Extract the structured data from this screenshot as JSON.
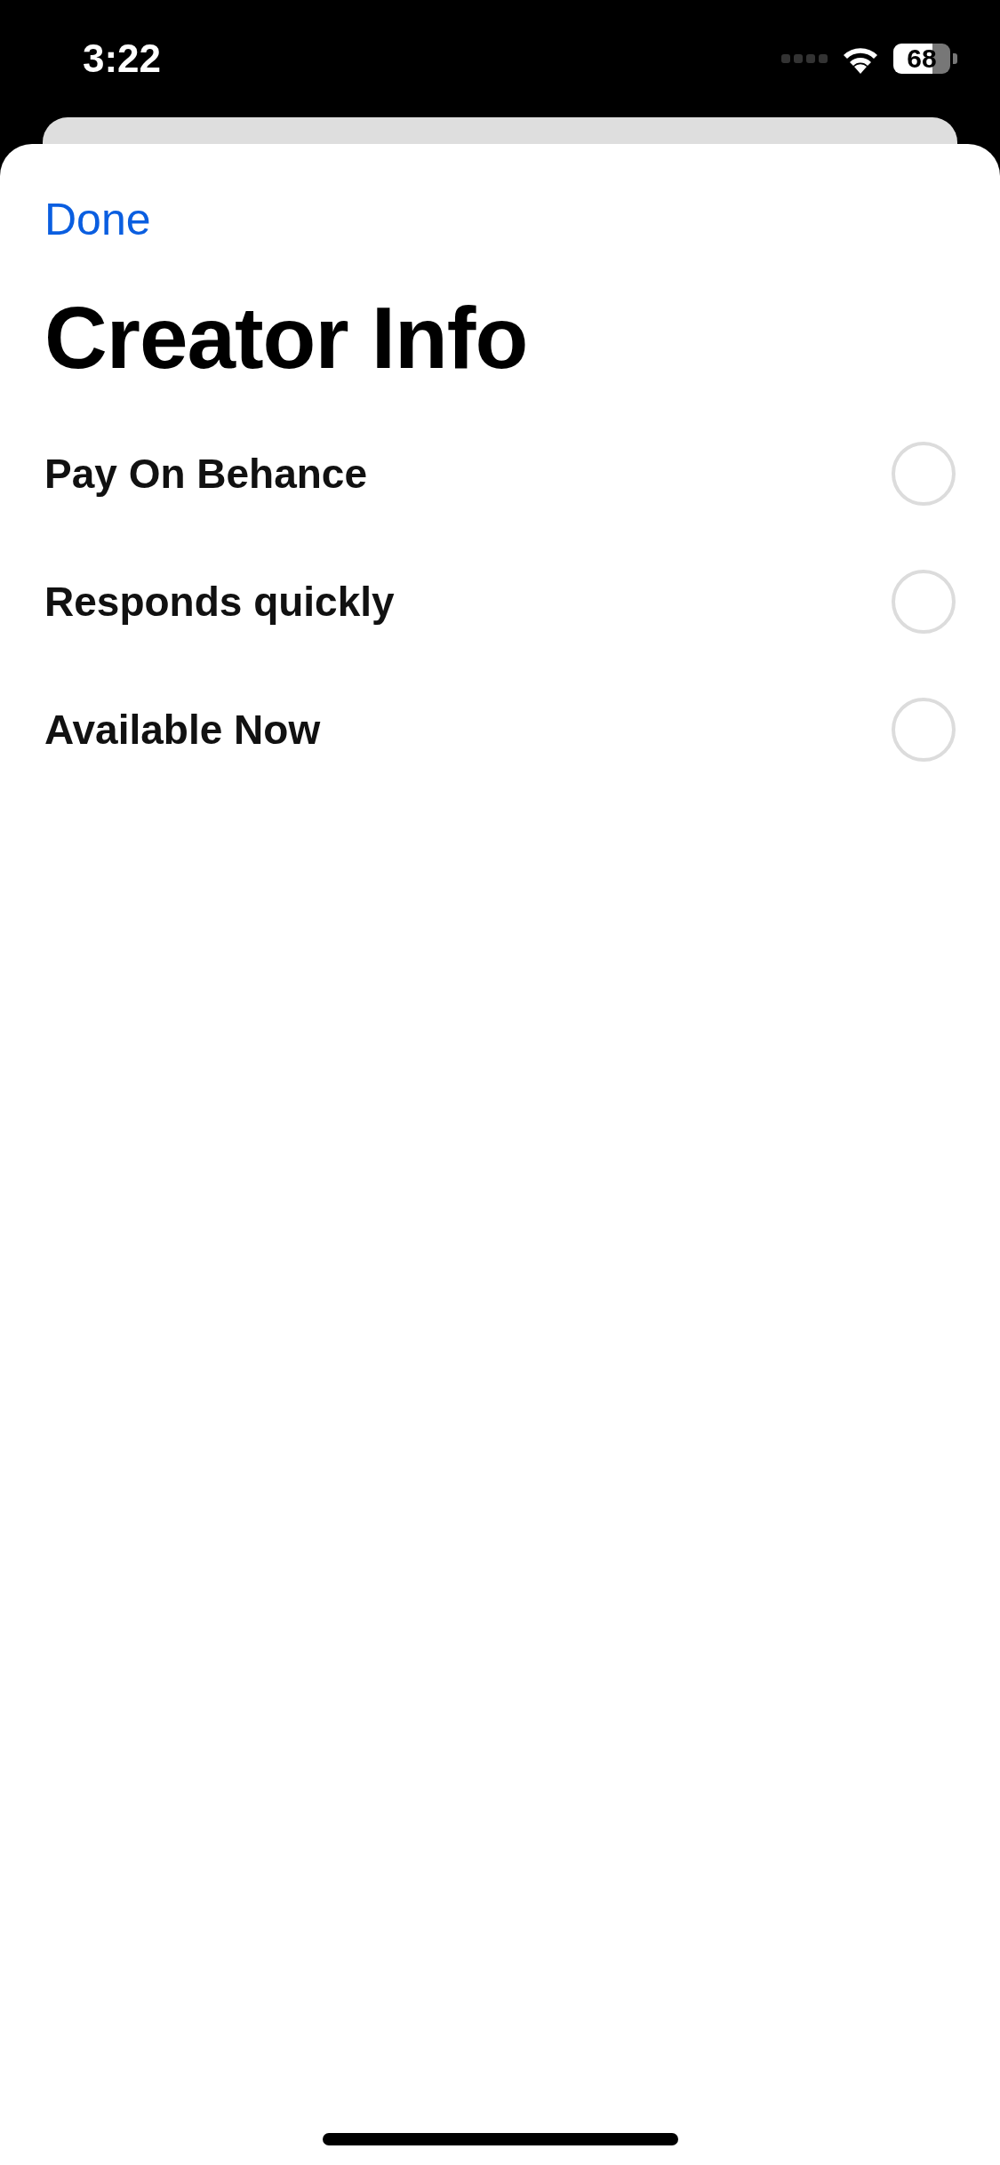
{
  "status_bar": {
    "time": "3:22",
    "battery": "68"
  },
  "sheet": {
    "done_button": "Done",
    "title": "Creator Info",
    "options": [
      {
        "label": "Pay On Behance",
        "checked": false
      },
      {
        "label": "Responds quickly",
        "checked": false
      },
      {
        "label": "Available Now",
        "checked": false
      }
    ]
  }
}
